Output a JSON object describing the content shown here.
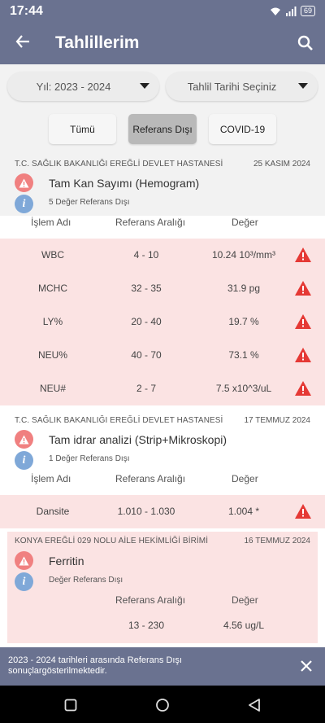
{
  "status_bar": {
    "time": "17:44",
    "battery": "69"
  },
  "app_bar": {
    "title": "Tahlillerim"
  },
  "filters": {
    "year_dropdown": "Yıl: 2023 - 2024",
    "date_dropdown": "Tahlil Tarihi Seçiniz",
    "segments": [
      "Tümü",
      "Referans Dışı",
      "COVID-19"
    ],
    "selected_segment": "Referans Dışı"
  },
  "columns": {
    "name": "İşlem Adı",
    "range": "Referans Aralığı",
    "value": "Değer"
  },
  "sections": [
    {
      "hospital": "T.C. SAĞLIK BAKANLIĞI EREĞLİ DEVLET HASTANESİ",
      "date": "25 KASIM 2024",
      "test_name": "Tam Kan Sayımı (Hemogram)",
      "out_of_range_info": "5 Değer Referans Dışı",
      "rows": [
        {
          "name": "WBC",
          "range": "4 - 10",
          "value": "10.24 10³/mm³"
        },
        {
          "name": "MCHC",
          "range": "32 - 35",
          "value": "31.9 pg"
        },
        {
          "name": "LY%",
          "range": "20 - 40",
          "value": "19.7 %"
        },
        {
          "name": "NEU%",
          "range": "40 - 70",
          "value": "73.1 %"
        },
        {
          "name": "NEU#",
          "range": "2 - 7",
          "value": "7.5 x10^3/uL"
        }
      ]
    },
    {
      "hospital": "T.C. SAĞLIK BAKANLIĞI EREĞLİ DEVLET HASTANESİ",
      "date": "17 TEMMUZ 2024",
      "test_name": "Tam idrar analizi (Strip+Mikroskopi)",
      "out_of_range_info": "1 Değer Referans Dışı",
      "rows": [
        {
          "name": "Dansite",
          "range": "1.010 - 1.030",
          "value": "1.004 *"
        }
      ]
    },
    {
      "hospital": "KONYA EREĞLİ 029 NOLU AİLE HEKİMLİĞİ BİRİMİ",
      "date": "16 TEMMUZ 2024",
      "test_name": "Ferritin",
      "out_of_range_info": "Değer Referans Dışı",
      "rows": [
        {
          "name": "",
          "range": "13 - 230",
          "value": "4.56 ug/L"
        }
      ]
    }
  ],
  "snackbar": {
    "message": "2023 - 2024 tarihleri arasında Referans Dışı sonuçlargösterilmektedir."
  },
  "colors": {
    "primary": "#6a7290",
    "alert_row": "#fbe3e3",
    "warning": "#e53935",
    "info": "#7fa8d8"
  }
}
